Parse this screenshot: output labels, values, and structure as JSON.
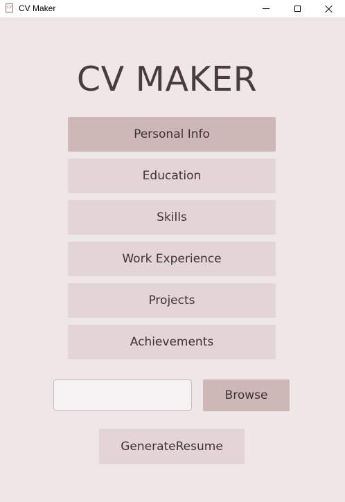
{
  "window": {
    "title": "CV Maker",
    "icon": "cv-document-icon",
    "icon_text": "CV",
    "controls": [
      "minimize-icon",
      "maximize-icon",
      "close-icon"
    ]
  },
  "app": {
    "title": "CV MAKER"
  },
  "nav": {
    "items": [
      {
        "label": "Personal Info"
      },
      {
        "label": "Education"
      },
      {
        "label": "Skills"
      },
      {
        "label": "Work Experience"
      },
      {
        "label": "Projects"
      },
      {
        "label": "Achievements"
      }
    ]
  },
  "file_picker": {
    "value": "",
    "browse_label": "Browse"
  },
  "actions": {
    "generate_label": "GenerateResume"
  },
  "colors": {
    "background": "#efe7e7",
    "button": "#e3d5d5",
    "button_active": "#cdb7b7",
    "text": "#3d3333"
  }
}
